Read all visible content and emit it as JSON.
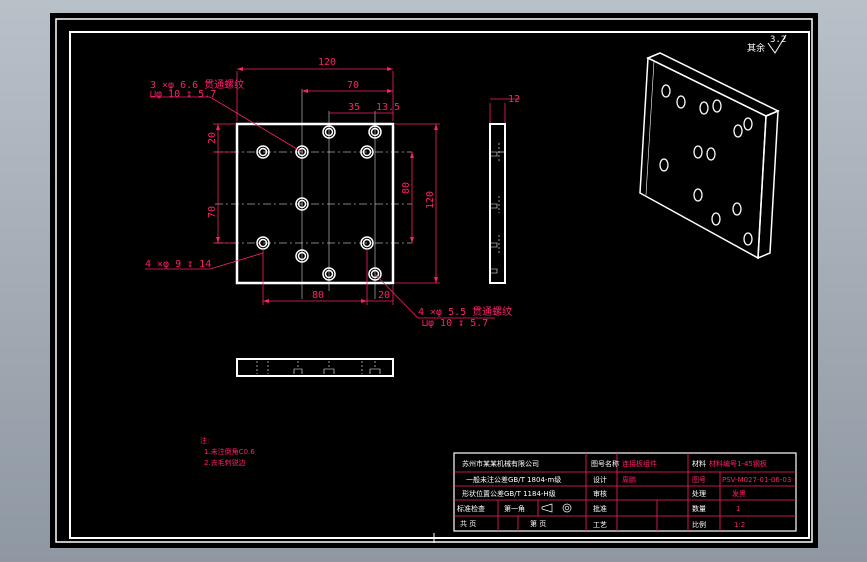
{
  "colors": {
    "outline": "#ffffff",
    "dimension": "#ff1f6a",
    "background": "#000000"
  },
  "roughness": {
    "symbol": "其余",
    "value": "3.2"
  },
  "dims": {
    "w120": "120",
    "d70": "70",
    "d35": "35",
    "d13_5": "13.5",
    "v20a": "20",
    "v70": "70",
    "v80": "80",
    "v120": "120",
    "b80": "80",
    "b20": "20",
    "t12": "12"
  },
  "callouts": {
    "c1_line1": "3 ×φ  6.6 贯通螺纹",
    "c1_line2": "⊔φ  10 ↧ 5.7",
    "c2": "4 ×φ  9 ↧ 14",
    "c3_line1": "4 ×φ  5.5 贯通螺纹",
    "c3_line2": "⊔φ  10 ↧ 5.7"
  },
  "notes": {
    "title": "注:",
    "line1": "1.未注倒角C0.6",
    "line2": "2.去毛刺锐边"
  },
  "title_block": {
    "company": "苏州市某某机械有限公司",
    "r2": "一般未注公差GB/T 1804-m级",
    "r3": "形状位置公差GB/T 1184-H级",
    "r4a": "标准检查",
    "r4b": "第一角",
    "r5a": "共 页",
    "r5b": "第 页",
    "lbl_name": "图号名称",
    "val_name": "连接板组件",
    "lbl_draw": "设计",
    "val_draw": "周鹏",
    "lbl_check": "审核",
    "lbl_approve": "批准",
    "lbl_craft": "工艺",
    "lbl_material": "材料",
    "val_material": "材料编号1-45钢板",
    "lbl_no": "图号",
    "val_no": "PSV-M027-01-06-03",
    "lbl_treat": "处理",
    "val_treat": "发黑",
    "lbl_qty": "数量",
    "val_qty": "1",
    "lbl_scale": "比例",
    "val_scale": "1:2"
  }
}
